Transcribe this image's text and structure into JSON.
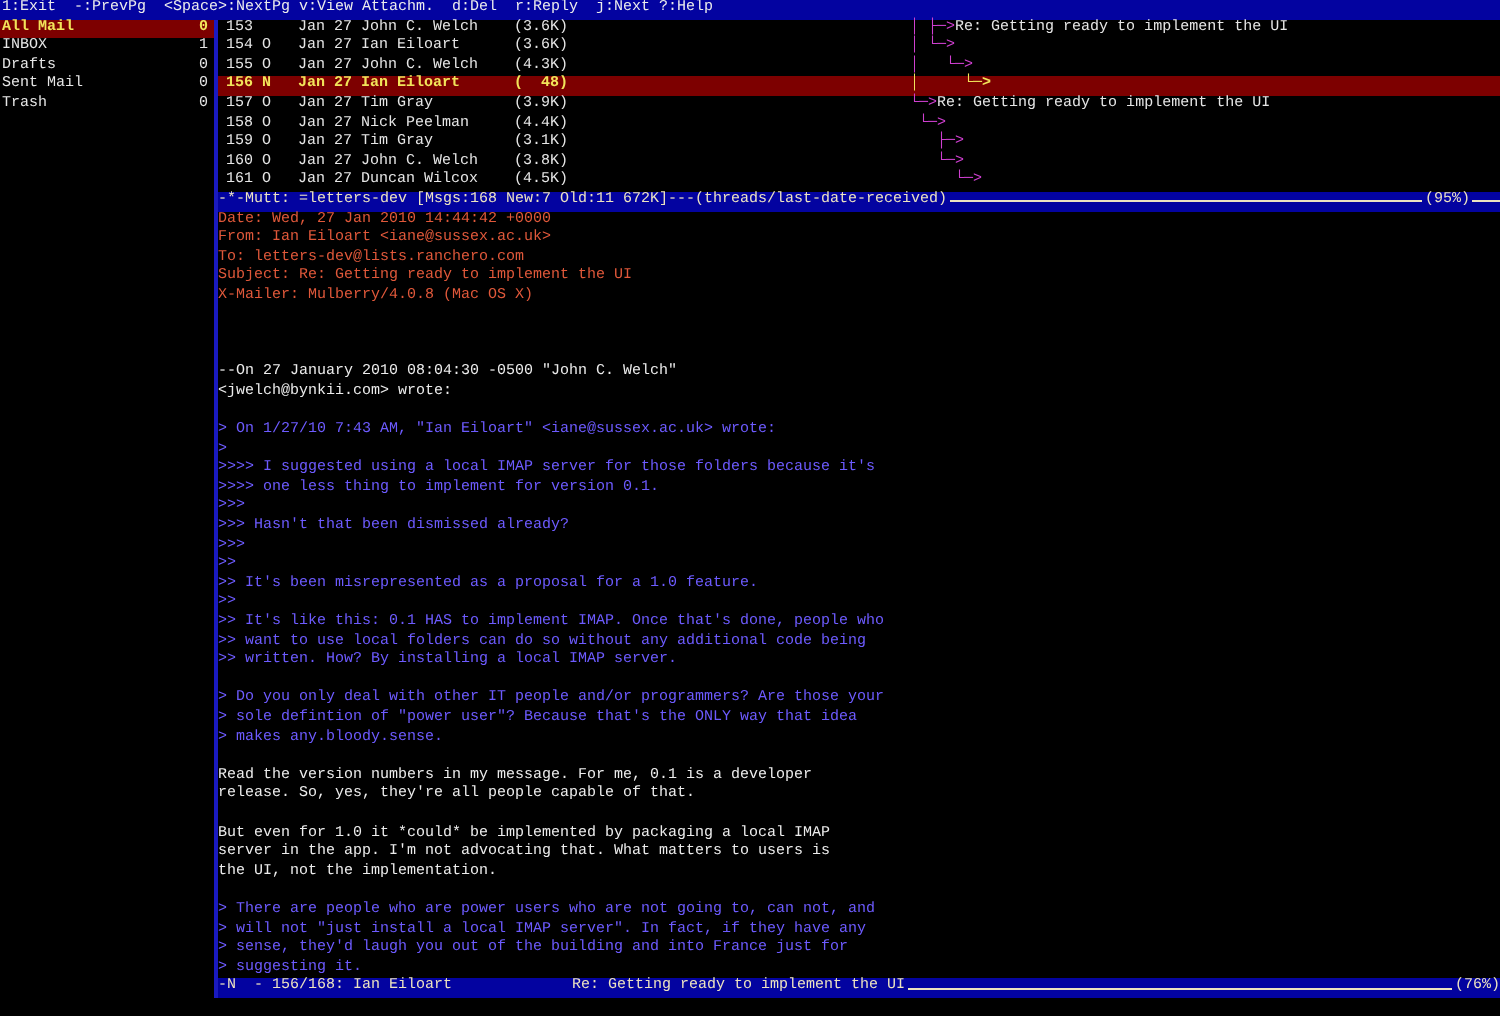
{
  "help_bar": {
    "text": "1:Exit  -:PrevPg  <Space>:NextPg v:View Attachm.  d:Del  r:Reply  j:Next ?:Help"
  },
  "sidebar": {
    "folders": [
      {
        "name": "All Mail",
        "count": "0",
        "selected": true
      },
      {
        "name": "INBOX",
        "count": "1",
        "selected": false
      },
      {
        "name": "Drafts",
        "count": "0",
        "selected": false
      },
      {
        "name": "Sent Mail",
        "count": "0",
        "selected": false
      },
      {
        "name": "Trash",
        "count": "0",
        "selected": false
      }
    ]
  },
  "index": {
    "rows": [
      {
        "number": "153",
        "date": "Jan 27",
        "author": "John C. Welch",
        "size": "(3.6K)",
        "tree": "│ ├─>",
        "subject": "Re: Getting ready to implement the UI",
        "selected": false
      },
      {
        "number": "154",
        "flag": "O",
        "date": "Jan 27",
        "author": "Ian Eiloart",
        "size": "(3.6K)",
        "tree": "│ └─>",
        "selected": false
      },
      {
        "number": "155",
        "flag": "O",
        "date": "Jan 27",
        "author": "John C. Welch",
        "size": "(4.3K)",
        "tree": "│   └─>",
        "selected": false
      },
      {
        "number": "156",
        "flag": "N",
        "date": "Jan 27",
        "author": "Ian Eiloart",
        "size": "(  48)",
        "tree": "│     └─>",
        "selected": true
      },
      {
        "number": "157",
        "flag": "O",
        "date": "Jan 27",
        "author": "Tim Gray",
        "size": "(3.9K)",
        "tree": "└─>",
        "subject": "Re: Getting ready to implement the UI",
        "selected": false
      },
      {
        "number": "158",
        "flag": "O",
        "date": "Jan 27",
        "author": "Nick Peelman",
        "size": "(4.4K)",
        "tree": " └─>",
        "selected": false
      },
      {
        "number": "159",
        "flag": "O",
        "date": "Jan 27",
        "author": "Tim Gray",
        "size": "(3.1K)",
        "tree": "   ├─>",
        "selected": false
      },
      {
        "number": "160",
        "flag": "O",
        "date": "Jan 27",
        "author": "John C. Welch",
        "size": "(3.8K)",
        "tree": "   └─>",
        "selected": false
      },
      {
        "number": "161",
        "flag": "O",
        "date": "Jan 27",
        "author": "Duncan Wilcox",
        "size": "(4.5K)",
        "tree": "     └─>",
        "selected": false
      }
    ]
  },
  "index_status": {
    "text": "-*-Mutt: =letters-dev [Msgs:168 New:7 Old:11 672K]---(threads/last-date-received)",
    "percent": "(95%)"
  },
  "pager": {
    "lines": [
      {
        "kind": "header",
        "text": "Date: Wed, 27 Jan 2010 14:44:42 +0000"
      },
      {
        "kind": "header",
        "text": "From: Ian Eiloart <iane@sussex.ac.uk>"
      },
      {
        "kind": "header",
        "text": "To: letters-dev@lists.ranchero.com"
      },
      {
        "kind": "header",
        "text": "Subject: Re: Getting ready to implement the UI"
      },
      {
        "kind": "header",
        "text": "X-Mailer: Mulberry/4.0.8 (Mac OS X)"
      },
      {
        "kind": "blank"
      },
      {
        "kind": "blank"
      },
      {
        "kind": "blank"
      },
      {
        "kind": "text",
        "text": "--On 27 January 2010 08:04:30 -0500 \"John C. Welch\""
      },
      {
        "kind": "text",
        "text": "<jwelch@bynkii.com> wrote:"
      },
      {
        "kind": "blank"
      },
      {
        "kind": "quote",
        "text": "> On 1/27/10 7:43 AM, \"Ian Eiloart\" <iane@sussex.ac.uk> wrote:"
      },
      {
        "kind": "quote",
        "text": ">"
      },
      {
        "kind": "quote",
        "text": ">>>> I suggested using a local IMAP server for those folders because it's"
      },
      {
        "kind": "quote",
        "text": ">>>> one less thing to implement for version 0.1."
      },
      {
        "kind": "quote",
        "text": ">>>"
      },
      {
        "kind": "quote",
        "text": ">>> Hasn't that been dismissed already?"
      },
      {
        "kind": "quote",
        "text": ">>>"
      },
      {
        "kind": "quote",
        "text": ">>"
      },
      {
        "kind": "quote",
        "text": ">> It's been misrepresented as a proposal for a 1.0 feature."
      },
      {
        "kind": "quote",
        "text": ">>"
      },
      {
        "kind": "quote",
        "text": ">> It's like this: 0.1 HAS to implement IMAP. Once that's done, people who"
      },
      {
        "kind": "quote",
        "text": ">> want to use local folders can do so without any additional code being"
      },
      {
        "kind": "quote",
        "text": ">> written. How? By installing a local IMAP server."
      },
      {
        "kind": "blank"
      },
      {
        "kind": "quote",
        "text": "> Do you only deal with other IT people and/or programmers? Are those your"
      },
      {
        "kind": "quote",
        "text": "> sole defintion of \"power user\"? Because that's the ONLY way that idea"
      },
      {
        "kind": "quote",
        "text": "> makes any.bloody.sense."
      },
      {
        "kind": "blank"
      },
      {
        "kind": "text",
        "text": "Read the version numbers in my message. For me, 0.1 is a developer"
      },
      {
        "kind": "text",
        "text": "release. So, yes, they're all people capable of that."
      },
      {
        "kind": "blank"
      },
      {
        "kind": "text",
        "text": "But even for 1.0 it *could* be implemented by packaging a local IMAP"
      },
      {
        "kind": "text",
        "text": "server in the app. I'm not advocating that. What matters to users is"
      },
      {
        "kind": "text",
        "text": "the UI, not the implementation."
      },
      {
        "kind": "blank"
      },
      {
        "kind": "quote",
        "text": "> There are people who are power users who are not going to, can not, and"
      },
      {
        "kind": "quote",
        "text": "> will not \"just install a local IMAP server\". In fact, if they have any"
      },
      {
        "kind": "quote",
        "text": "> sense, they'd laugh you out of the building and into France just for"
      },
      {
        "kind": "quote",
        "text": "> suggesting it."
      }
    ]
  },
  "pager_status": {
    "text": "-N  - 156/168: Ian Eiloart",
    "subject": "Re: Getting ready to implement the UI",
    "percent": "(76%)"
  }
}
